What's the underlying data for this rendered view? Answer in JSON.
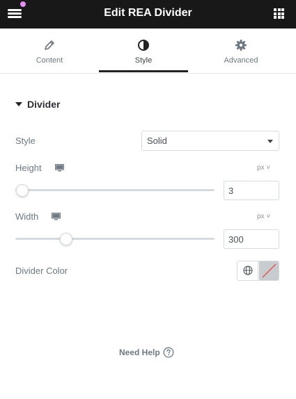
{
  "header": {
    "title": "Edit REA Divider",
    "menu_icon": "hamburger-icon",
    "apps_icon": "grid-icon",
    "notification_color": "#e48ef0"
  },
  "tabs": [
    {
      "label": "Content",
      "icon": "pencil-icon",
      "active": false
    },
    {
      "label": "Style",
      "icon": "half-circle-icon",
      "active": true
    },
    {
      "label": "Advanced",
      "icon": "gear-icon",
      "active": false
    }
  ],
  "section": {
    "title": "Divider",
    "expanded": true
  },
  "controls": {
    "style": {
      "label": "Style",
      "value": "Solid"
    },
    "height": {
      "label": "Height",
      "unit": "px",
      "value": "3",
      "slider_fraction": 0.03
    },
    "width": {
      "label": "Width",
      "unit": "px",
      "value": "300",
      "slider_fraction": 0.25
    },
    "divider_color": {
      "label": "Divider Color"
    }
  },
  "footer": {
    "help_text": "Need Help"
  }
}
